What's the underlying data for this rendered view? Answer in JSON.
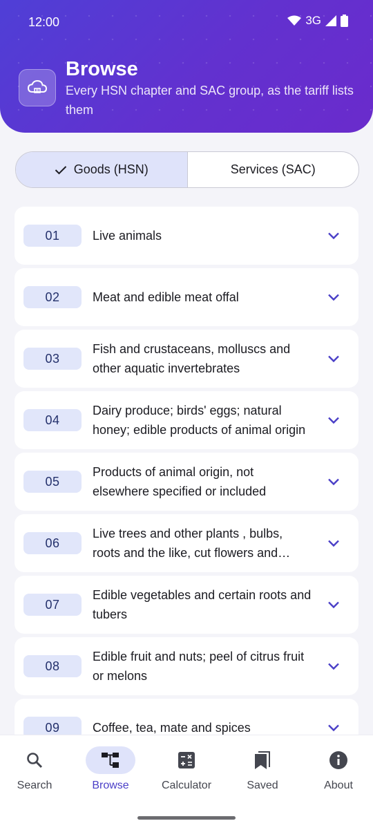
{
  "status_bar": {
    "time": "12:00",
    "network": "3G"
  },
  "header": {
    "title": "Browse",
    "subtitle": "Every HSN chapter and SAC group, as the tariff lists them",
    "icon": "cloud-icon"
  },
  "segmented": {
    "goods_label": "Goods (HSN)",
    "services_label": "Services (SAC)",
    "selected": "goods"
  },
  "chapters": [
    {
      "code": "01",
      "title": "Live animals"
    },
    {
      "code": "02",
      "title": "Meat and edible meat offal"
    },
    {
      "code": "03",
      "title": "Fish and crustaceans, molluscs and other aquatic invertebrates"
    },
    {
      "code": "04",
      "title": "Dairy produce; birds' eggs; natural honey; edible products of animal origin"
    },
    {
      "code": "05",
      "title": "Products of animal origin, not elsewhere specified or included"
    },
    {
      "code": "06",
      "title": "Live trees and other plants , bulbs, roots and the like, cut flowers and ornamental foliage"
    },
    {
      "code": "07",
      "title": "Edible vegetables and certain roots and tubers"
    },
    {
      "code": "08",
      "title": "Edible fruit and nuts; peel of citrus fruit or melons"
    },
    {
      "code": "09",
      "title": "Coffee, tea, mate and spices"
    }
  ],
  "nav": {
    "items": [
      {
        "label": "Search",
        "icon": "search-icon"
      },
      {
        "label": "Browse",
        "icon": "browse-icon"
      },
      {
        "label": "Calculator",
        "icon": "calculator-icon"
      },
      {
        "label": "Saved",
        "icon": "bookmark-icon"
      },
      {
        "label": "About",
        "icon": "info-icon"
      }
    ],
    "active": "Browse"
  },
  "colors": {
    "header_start": "#4f3fd6",
    "header_end": "#6a2bcc",
    "accent": "#4a3fc7",
    "badge_bg": "#e1e6fa"
  }
}
